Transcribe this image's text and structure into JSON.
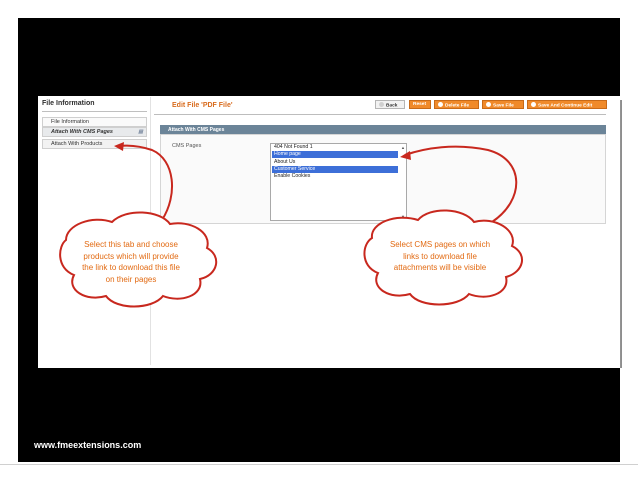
{
  "footer": {
    "website": "www.fmeextensions.com"
  },
  "sidebar": {
    "title": "File Information",
    "items": [
      {
        "label": "File Information"
      },
      {
        "label": "Attach With CMS Pages"
      },
      {
        "label": "Attach With Products"
      }
    ]
  },
  "page": {
    "title": "Edit File 'PDF File'"
  },
  "toolbar": {
    "back": "Back",
    "reset": "Reset",
    "delete": "Delete File",
    "save": "Save File",
    "save_continue": "Save And Continue Edit"
  },
  "section": {
    "header": "Attach With CMS Pages",
    "field_label": "CMS Pages",
    "options": [
      {
        "label": "404 Not Found 1",
        "selected": false
      },
      {
        "label": "Home page",
        "selected": true
      },
      {
        "label": "About Us",
        "selected": false
      },
      {
        "label": "Customer Service",
        "selected": true
      },
      {
        "label": "Enable Cookies",
        "selected": false
      }
    ]
  },
  "callouts": {
    "left_lines": [
      "Select this tab and choose",
      "products which will provide",
      "the link to download this file",
      "on their pages"
    ],
    "right_lines": [
      "Select CMS pages on which",
      "links to download file",
      "attachments will be visible"
    ]
  },
  "colors": {
    "accent": "#d86b1d",
    "button": "#f08a2a",
    "section_header": "#6b8498",
    "selection": "#3d6fd8",
    "callout_stroke": "#c8281e",
    "callout_text": "#e26a12"
  },
  "icons": {
    "back": "back-circle-icon",
    "reset": "reset-icon",
    "delete": "delete-icon",
    "save": "save-icon",
    "save_continue": "save-continue-icon"
  }
}
